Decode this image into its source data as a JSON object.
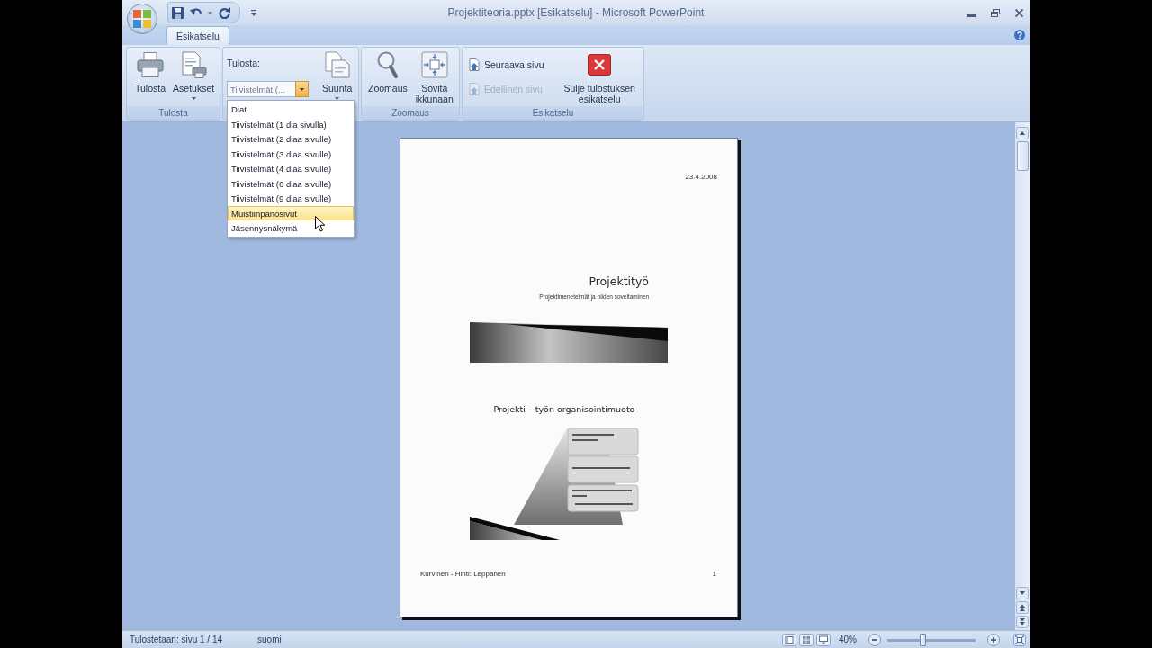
{
  "window": {
    "title": "Projektiteoria.pptx [Esikatselu] - Microsoft PowerPoint"
  },
  "tabs": [
    {
      "label": "Esikatselu",
      "selected": true
    }
  ],
  "ribbon": {
    "groups": [
      {
        "label": "Tulosta",
        "controls": [
          {
            "kind": "large",
            "label": "Tulosta",
            "has_menu": false,
            "disabled": false
          },
          {
            "kind": "large",
            "label": "Asetukset",
            "has_menu": true,
            "disabled": false
          }
        ]
      },
      {
        "controls": [
          {
            "kind": "combo",
            "label": "Tulosta:",
            "value": "Tiivistelmät (...",
            "expanded": true,
            "menu": [
              {
                "label": "Diat",
                "highlighted": false
              },
              {
                "label": "Tiivistelmät (1 dia sivulla)",
                "highlighted": false
              },
              {
                "label": "Tiivistelmät (2 diaa sivulle)",
                "highlighted": false
              },
              {
                "label": "Tiivistelmät (3 diaa sivulle)",
                "highlighted": false
              },
              {
                "label": "Tiivistelmät (4 diaa sivulle)",
                "highlighted": false
              },
              {
                "label": "Tiivistelmät (6 diaa sivulle)",
                "highlighted": false
              },
              {
                "label": "Tiivistelmät (9 diaa sivulle)",
                "highlighted": false
              },
              {
                "label": "Muistiinpanosivut",
                "highlighted": true
              },
              {
                "label": "Jäsennysnäkymä",
                "highlighted": false
              }
            ]
          },
          {
            "kind": "large",
            "label": "Suunta",
            "has_menu": true,
            "disabled": false
          }
        ]
      },
      {
        "label": "Zoomaus",
        "controls": [
          {
            "kind": "large",
            "label": "Zoomaus",
            "has_menu": false,
            "disabled": false
          },
          {
            "kind": "large",
            "label": "Sovita ikkunaan",
            "has_menu": false,
            "disabled": false
          }
        ]
      },
      {
        "label": "Esikatselu",
        "controls": [
          {
            "kind": "small_stack",
            "items": [
              {
                "label": "Seuraava sivu",
                "disabled": false
              },
              {
                "label": "Edellinen sivu",
                "disabled": true
              }
            ]
          },
          {
            "kind": "large",
            "label": "Sulje tulostuksen esikatselu",
            "has_menu": false,
            "disabled": false
          }
        ]
      }
    ]
  },
  "page": {
    "date": "23.4.2008",
    "slides": [
      {
        "kind": "title",
        "title": "Projektityö",
        "subtitle": "Projektimenetelmät ja niiden soveltaminen"
      },
      {
        "kind": "diagram",
        "title": "Projekti – työn organisointimuoto"
      }
    ],
    "footer": "Kurvinen - Hinti: Leppänen",
    "page_number": "1"
  },
  "status_bar": {
    "page_info": "Tulostetaan: sivu 1 / 14",
    "language": "suomi",
    "zoom": "40%",
    "zoom_slider": {
      "level": 0.4
    }
  }
}
